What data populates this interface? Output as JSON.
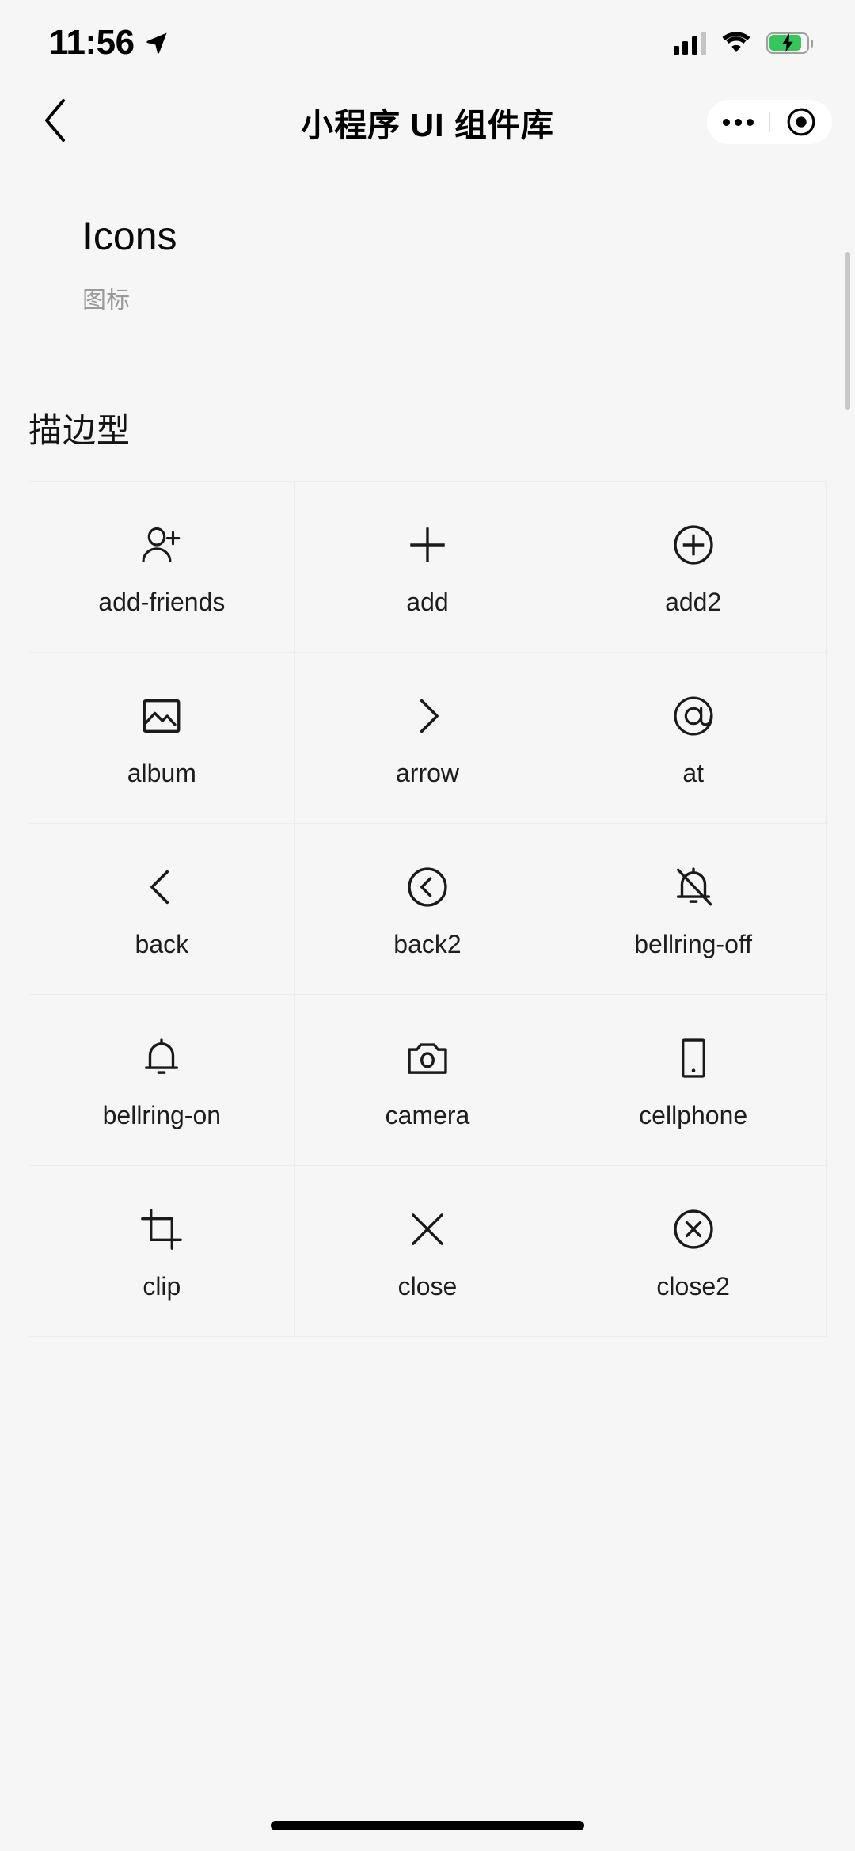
{
  "status_bar": {
    "time": "11:56",
    "location_icon": "location-arrow-icon",
    "signal_icon": "cellular-signal-icon",
    "wifi_icon": "wifi-icon",
    "battery_icon": "battery-charging-icon",
    "battery_color": "#34c759"
  },
  "nav": {
    "back_icon": "back-chevron-icon",
    "title": "小程序 UI 组件库",
    "capsule": {
      "more_icon": "more-dots-icon",
      "target_icon": "mini-program-target-icon"
    }
  },
  "page": {
    "title": "Icons",
    "subtitle": "图标"
  },
  "section": {
    "title": "描边型"
  },
  "icons": [
    {
      "name": "add-friends",
      "icon": "add-friends-icon"
    },
    {
      "name": "add",
      "icon": "plus-icon"
    },
    {
      "name": "add2",
      "icon": "plus-circle-icon"
    },
    {
      "name": "album",
      "icon": "image-icon"
    },
    {
      "name": "arrow",
      "icon": "chevron-right-icon"
    },
    {
      "name": "at",
      "icon": "at-sign-icon"
    },
    {
      "name": "back",
      "icon": "chevron-left-icon"
    },
    {
      "name": "back2",
      "icon": "chevron-left-circle-icon"
    },
    {
      "name": "bellring-off",
      "icon": "bell-off-icon"
    },
    {
      "name": "bellring-on",
      "icon": "bell-icon"
    },
    {
      "name": "camera",
      "icon": "camera-icon"
    },
    {
      "name": "cellphone",
      "icon": "cellphone-icon"
    },
    {
      "name": "clip",
      "icon": "crop-icon"
    },
    {
      "name": "close",
      "icon": "x-icon"
    },
    {
      "name": "close2",
      "icon": "x-circle-icon"
    }
  ],
  "colors": {
    "background": "#f6f6f6",
    "text": "#1d1d1d",
    "muted": "#9a9a9a",
    "grid_line": "#ededed"
  }
}
